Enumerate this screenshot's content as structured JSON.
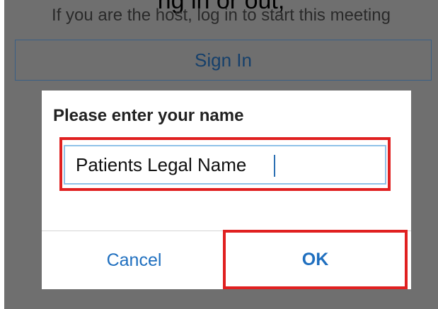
{
  "background": {
    "clipped_text": "ng in or out,",
    "host_notice": "If you are the host, log in to start this meeting",
    "sign_in_label": "Sign In"
  },
  "dialog": {
    "title": "Please enter your name",
    "name_value": "Patients Legal Name",
    "cancel_label": "Cancel",
    "ok_label": "OK"
  },
  "colors": {
    "overlay": "#6f6f6f",
    "accent": "#1f6fbf",
    "highlight": "#e02020",
    "input_border": "#8fc2e8"
  }
}
